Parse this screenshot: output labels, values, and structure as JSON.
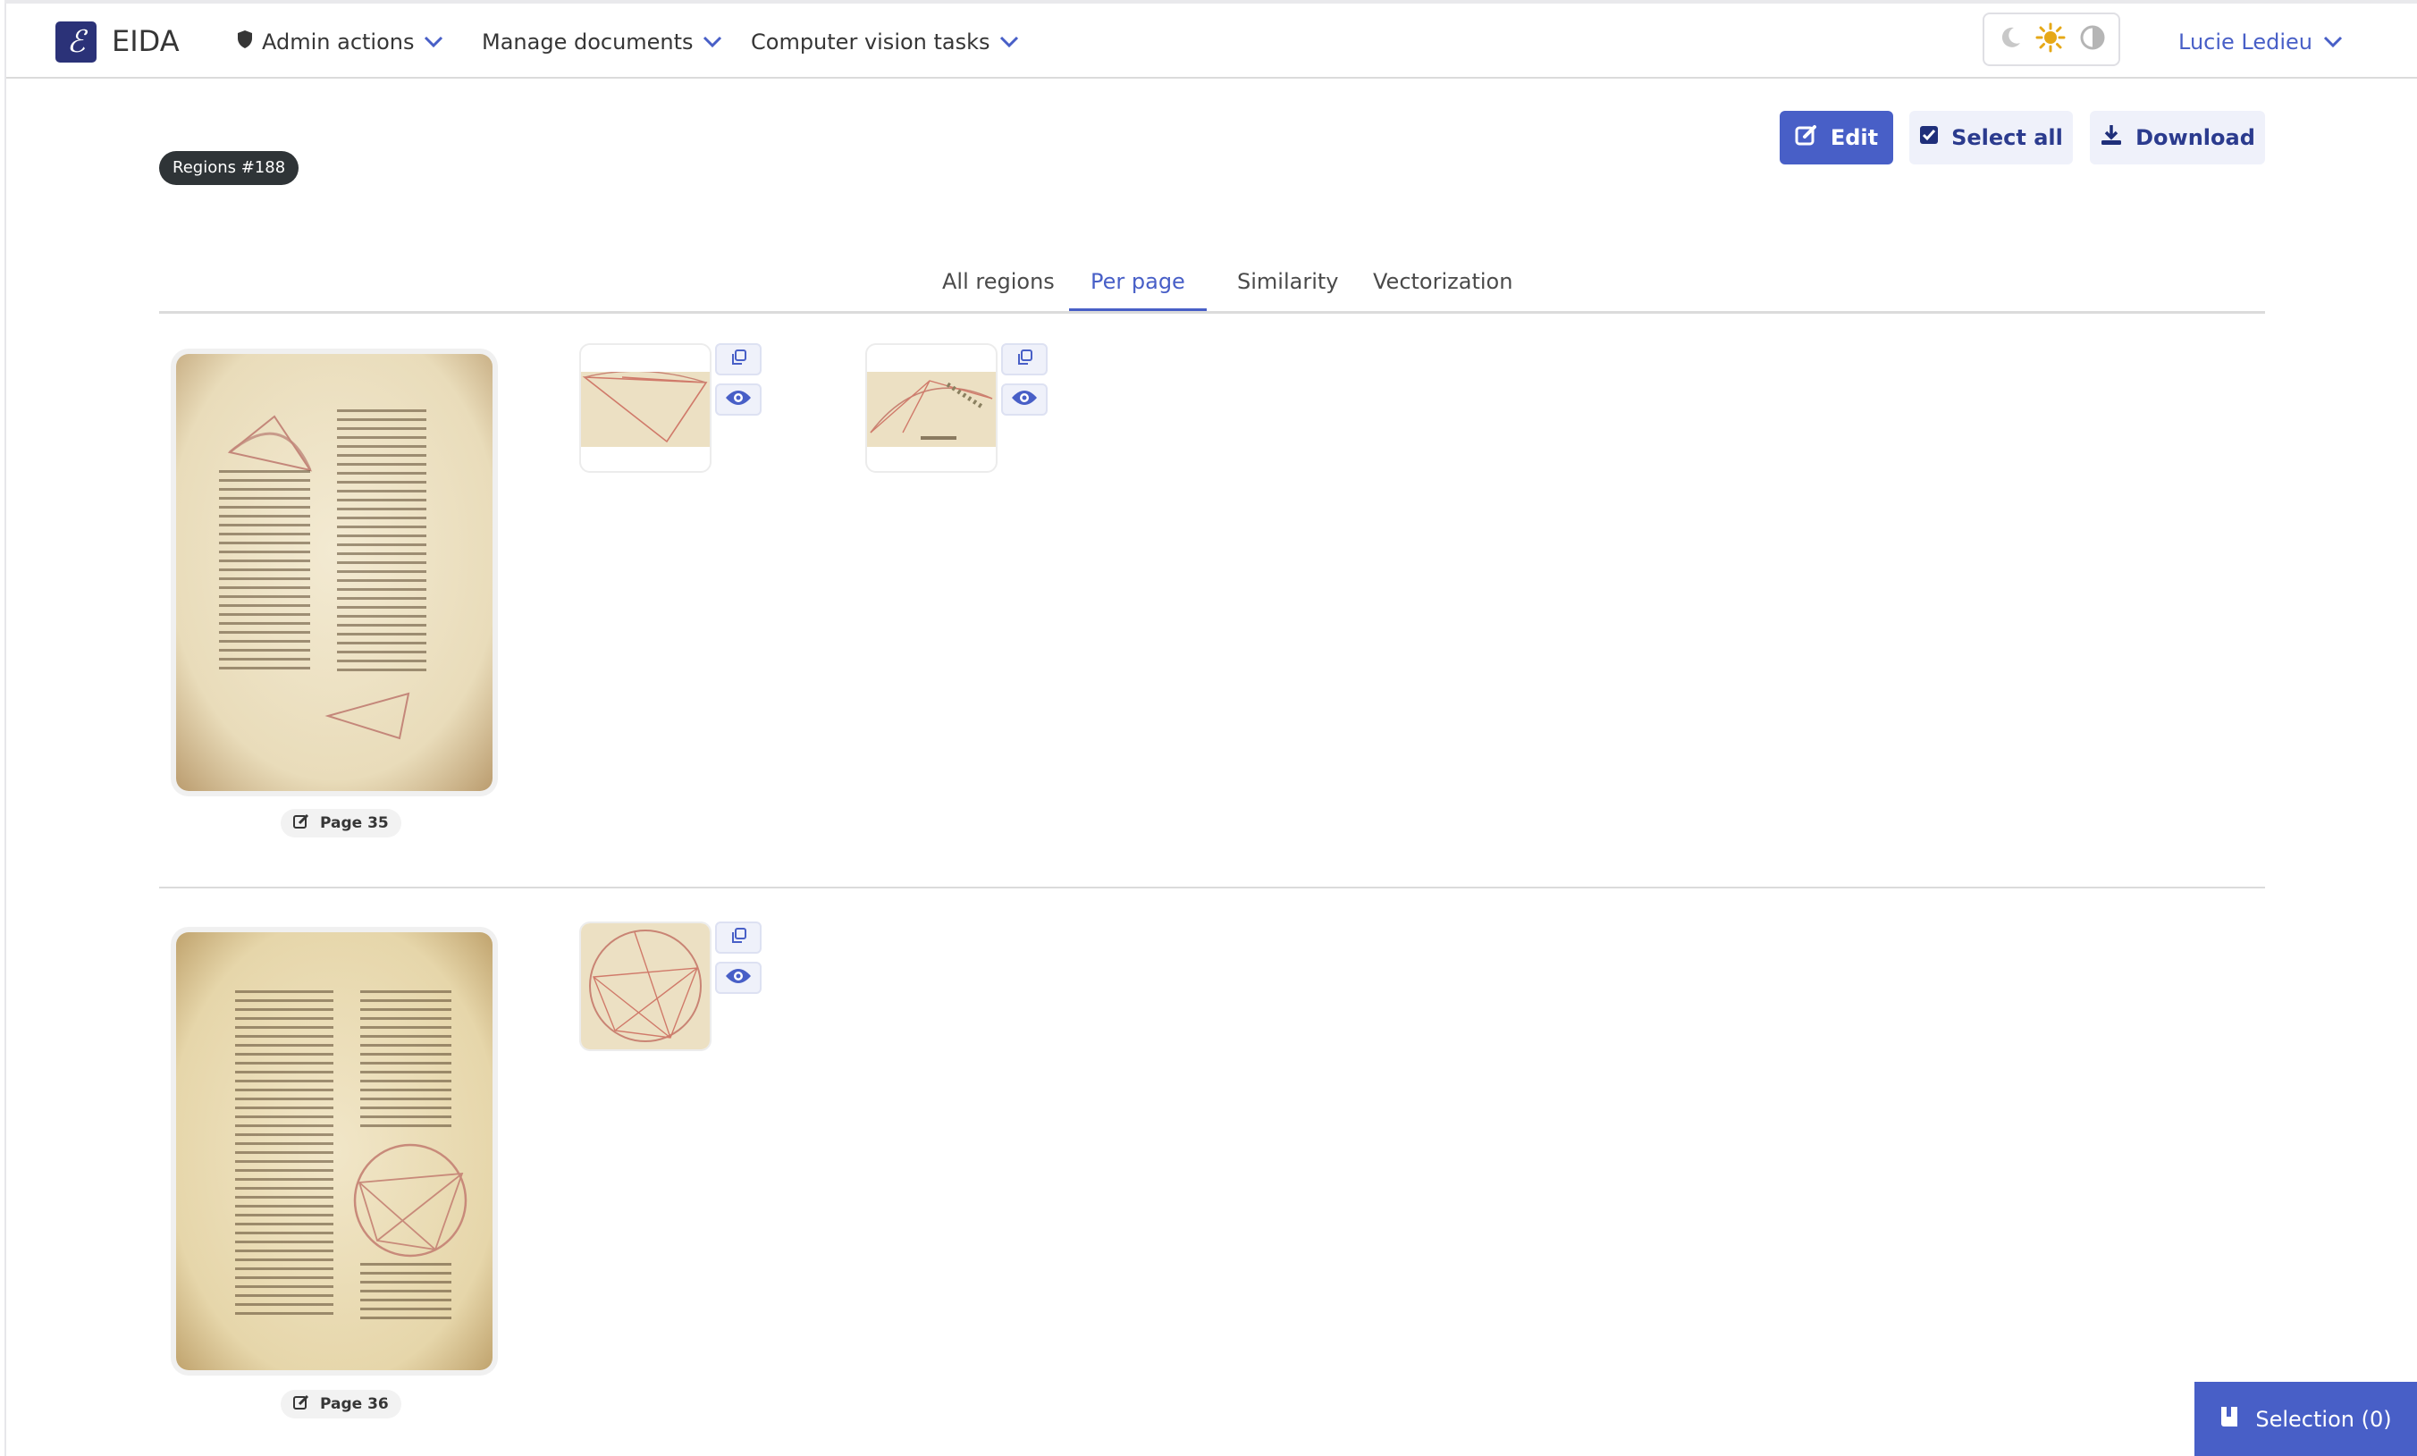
{
  "app": {
    "name": "EIDA",
    "logo_glyph": "ℰ"
  },
  "nav": {
    "admin_actions": "Admin actions",
    "manage_documents": "Manage documents",
    "cv_tasks": "Computer vision tasks",
    "user": "Lucie Ledieu"
  },
  "header": {
    "badge": "Regions #188",
    "edit": "Edit",
    "select_all": "Select all",
    "download": "Download"
  },
  "tabs": [
    {
      "label": "All regions",
      "active": false
    },
    {
      "label": "Per page",
      "active": true
    },
    {
      "label": "Similarity",
      "active": false
    },
    {
      "label": "Vectorization",
      "active": false
    }
  ],
  "pages": [
    {
      "label": "Page 35",
      "regions": 2
    },
    {
      "label": "Page 36",
      "regions": 1
    }
  ],
  "selection": {
    "label": "Selection (0)"
  },
  "colors": {
    "accent": "#485fc7",
    "badge_bg": "#2f3437",
    "light_btn": "#eff1fa",
    "theme_sun": "#e6a817"
  },
  "icons": [
    "shield-icon",
    "chevron-down-icon",
    "moon-icon",
    "sun-icon",
    "contrast-icon",
    "edit-icon",
    "checkbox-icon",
    "download-icon",
    "copy-icon",
    "eye-icon",
    "book-icon"
  ]
}
